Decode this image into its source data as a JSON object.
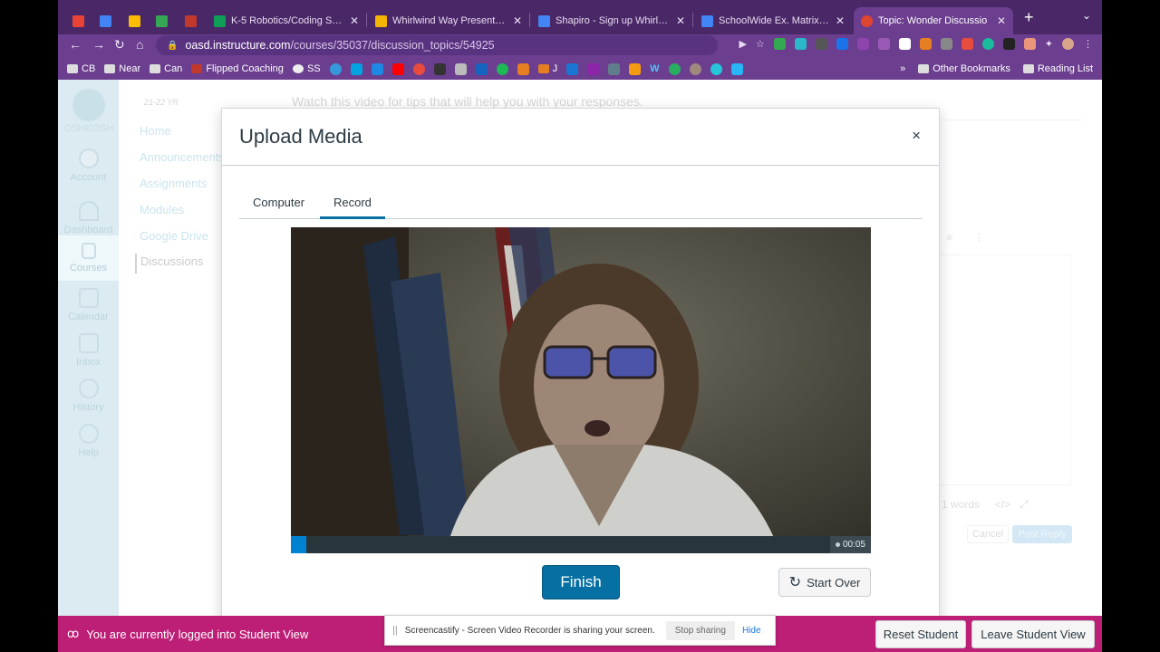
{
  "browser": {
    "tabs": [
      {
        "label": "",
        "color": "#ea4335"
      },
      {
        "label": "",
        "color": "#4285f4"
      },
      {
        "label": "",
        "color": "#fbbc04"
      },
      {
        "label": "",
        "color": "#34a853"
      },
      {
        "label": "",
        "color": "#c0392b"
      },
      {
        "label": "K-5 Robotics/Coding Scope",
        "color": "#0f9d58"
      },
      {
        "label": "Whirlwind Way Presentation",
        "color": "#f4b400"
      },
      {
        "label": "Shapiro - Sign up Whirlwind",
        "color": "#4285f4"
      },
      {
        "label": "SchoolWide Ex. Matrix - Goo",
        "color": "#4285f4"
      },
      {
        "label": "Topic: Wonder Discussio",
        "color": "#e0452f"
      }
    ],
    "new_tab": "+",
    "url_domain": "oasd.instructure.com",
    "url_path": "/courses/35037/discussion_topics/54925",
    "bookmarks": [
      "CB",
      "Near",
      "Can",
      "Flipped Coaching",
      "SS",
      "J",
      "W"
    ],
    "bookmarks_overflow": "»",
    "other_bookmarks": "Other Bookmarks",
    "reading_list": "Reading List"
  },
  "canvas": {
    "logo_text": "OSHKOSH",
    "global_nav": [
      {
        "label": "Account"
      },
      {
        "label": "Dashboard"
      },
      {
        "label": "Courses"
      },
      {
        "label": "Calendar"
      },
      {
        "label": "Inbox"
      },
      {
        "label": "History"
      },
      {
        "label": "Help"
      }
    ],
    "term": "21-22 YR",
    "course_nav": [
      "Home",
      "Announcements",
      "Assignments",
      "Modules",
      "Google Drive",
      "Discussions"
    ],
    "bg_prompt": "Watch this video for tips that will help you with your responses.",
    "word_count": "1 words",
    "cancel": "Cancel",
    "post_reply": "Post Reply"
  },
  "modal": {
    "title": "Upload Media",
    "close": "×",
    "tabs": [
      "Computer",
      "Record"
    ],
    "active_tab": "Record",
    "progress_fraction": 0.027,
    "elapsed": "00:05",
    "finish": "Finish",
    "start_over": "Start Over"
  },
  "student_view": {
    "message": "You are currently logged into Student View",
    "reset": "Reset Student",
    "leave": "Leave Student View"
  },
  "screencastify": {
    "message": "Screencastify - Screen Video Recorder is sharing your screen.",
    "stop": "Stop sharing",
    "hide": "Hide"
  },
  "colors": {
    "browser_chrome": "#6b3e8f",
    "canvas_primary": "#0770a3",
    "student_view_bar": "#bd1e76"
  }
}
